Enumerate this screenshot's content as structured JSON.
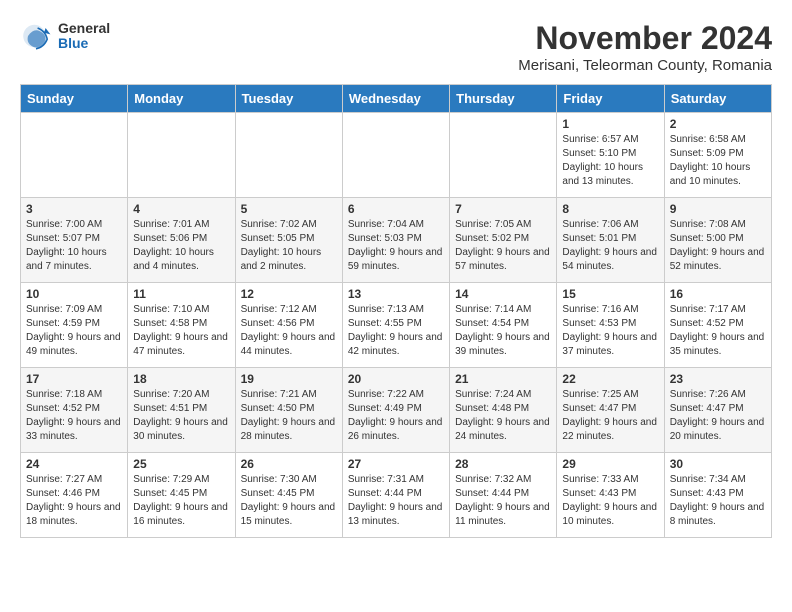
{
  "header": {
    "logo_general": "General",
    "logo_blue": "Blue",
    "month": "November 2024",
    "location": "Merisani, Teleorman County, Romania"
  },
  "days_of_week": [
    "Sunday",
    "Monday",
    "Tuesday",
    "Wednesday",
    "Thursday",
    "Friday",
    "Saturday"
  ],
  "weeks": [
    [
      {
        "day": "",
        "info": ""
      },
      {
        "day": "",
        "info": ""
      },
      {
        "day": "",
        "info": ""
      },
      {
        "day": "",
        "info": ""
      },
      {
        "day": "",
        "info": ""
      },
      {
        "day": "1",
        "info": "Sunrise: 6:57 AM\nSunset: 5:10 PM\nDaylight: 10 hours and 13 minutes."
      },
      {
        "day": "2",
        "info": "Sunrise: 6:58 AM\nSunset: 5:09 PM\nDaylight: 10 hours and 10 minutes."
      }
    ],
    [
      {
        "day": "3",
        "info": "Sunrise: 7:00 AM\nSunset: 5:07 PM\nDaylight: 10 hours and 7 minutes."
      },
      {
        "day": "4",
        "info": "Sunrise: 7:01 AM\nSunset: 5:06 PM\nDaylight: 10 hours and 4 minutes."
      },
      {
        "day": "5",
        "info": "Sunrise: 7:02 AM\nSunset: 5:05 PM\nDaylight: 10 hours and 2 minutes."
      },
      {
        "day": "6",
        "info": "Sunrise: 7:04 AM\nSunset: 5:03 PM\nDaylight: 9 hours and 59 minutes."
      },
      {
        "day": "7",
        "info": "Sunrise: 7:05 AM\nSunset: 5:02 PM\nDaylight: 9 hours and 57 minutes."
      },
      {
        "day": "8",
        "info": "Sunrise: 7:06 AM\nSunset: 5:01 PM\nDaylight: 9 hours and 54 minutes."
      },
      {
        "day": "9",
        "info": "Sunrise: 7:08 AM\nSunset: 5:00 PM\nDaylight: 9 hours and 52 minutes."
      }
    ],
    [
      {
        "day": "10",
        "info": "Sunrise: 7:09 AM\nSunset: 4:59 PM\nDaylight: 9 hours and 49 minutes."
      },
      {
        "day": "11",
        "info": "Sunrise: 7:10 AM\nSunset: 4:58 PM\nDaylight: 9 hours and 47 minutes."
      },
      {
        "day": "12",
        "info": "Sunrise: 7:12 AM\nSunset: 4:56 PM\nDaylight: 9 hours and 44 minutes."
      },
      {
        "day": "13",
        "info": "Sunrise: 7:13 AM\nSunset: 4:55 PM\nDaylight: 9 hours and 42 minutes."
      },
      {
        "day": "14",
        "info": "Sunrise: 7:14 AM\nSunset: 4:54 PM\nDaylight: 9 hours and 39 minutes."
      },
      {
        "day": "15",
        "info": "Sunrise: 7:16 AM\nSunset: 4:53 PM\nDaylight: 9 hours and 37 minutes."
      },
      {
        "day": "16",
        "info": "Sunrise: 7:17 AM\nSunset: 4:52 PM\nDaylight: 9 hours and 35 minutes."
      }
    ],
    [
      {
        "day": "17",
        "info": "Sunrise: 7:18 AM\nSunset: 4:52 PM\nDaylight: 9 hours and 33 minutes."
      },
      {
        "day": "18",
        "info": "Sunrise: 7:20 AM\nSunset: 4:51 PM\nDaylight: 9 hours and 30 minutes."
      },
      {
        "day": "19",
        "info": "Sunrise: 7:21 AM\nSunset: 4:50 PM\nDaylight: 9 hours and 28 minutes."
      },
      {
        "day": "20",
        "info": "Sunrise: 7:22 AM\nSunset: 4:49 PM\nDaylight: 9 hours and 26 minutes."
      },
      {
        "day": "21",
        "info": "Sunrise: 7:24 AM\nSunset: 4:48 PM\nDaylight: 9 hours and 24 minutes."
      },
      {
        "day": "22",
        "info": "Sunrise: 7:25 AM\nSunset: 4:47 PM\nDaylight: 9 hours and 22 minutes."
      },
      {
        "day": "23",
        "info": "Sunrise: 7:26 AM\nSunset: 4:47 PM\nDaylight: 9 hours and 20 minutes."
      }
    ],
    [
      {
        "day": "24",
        "info": "Sunrise: 7:27 AM\nSunset: 4:46 PM\nDaylight: 9 hours and 18 minutes."
      },
      {
        "day": "25",
        "info": "Sunrise: 7:29 AM\nSunset: 4:45 PM\nDaylight: 9 hours and 16 minutes."
      },
      {
        "day": "26",
        "info": "Sunrise: 7:30 AM\nSunset: 4:45 PM\nDaylight: 9 hours and 15 minutes."
      },
      {
        "day": "27",
        "info": "Sunrise: 7:31 AM\nSunset: 4:44 PM\nDaylight: 9 hours and 13 minutes."
      },
      {
        "day": "28",
        "info": "Sunrise: 7:32 AM\nSunset: 4:44 PM\nDaylight: 9 hours and 11 minutes."
      },
      {
        "day": "29",
        "info": "Sunrise: 7:33 AM\nSunset: 4:43 PM\nDaylight: 9 hours and 10 minutes."
      },
      {
        "day": "30",
        "info": "Sunrise: 7:34 AM\nSunset: 4:43 PM\nDaylight: 9 hours and 8 minutes."
      }
    ]
  ]
}
